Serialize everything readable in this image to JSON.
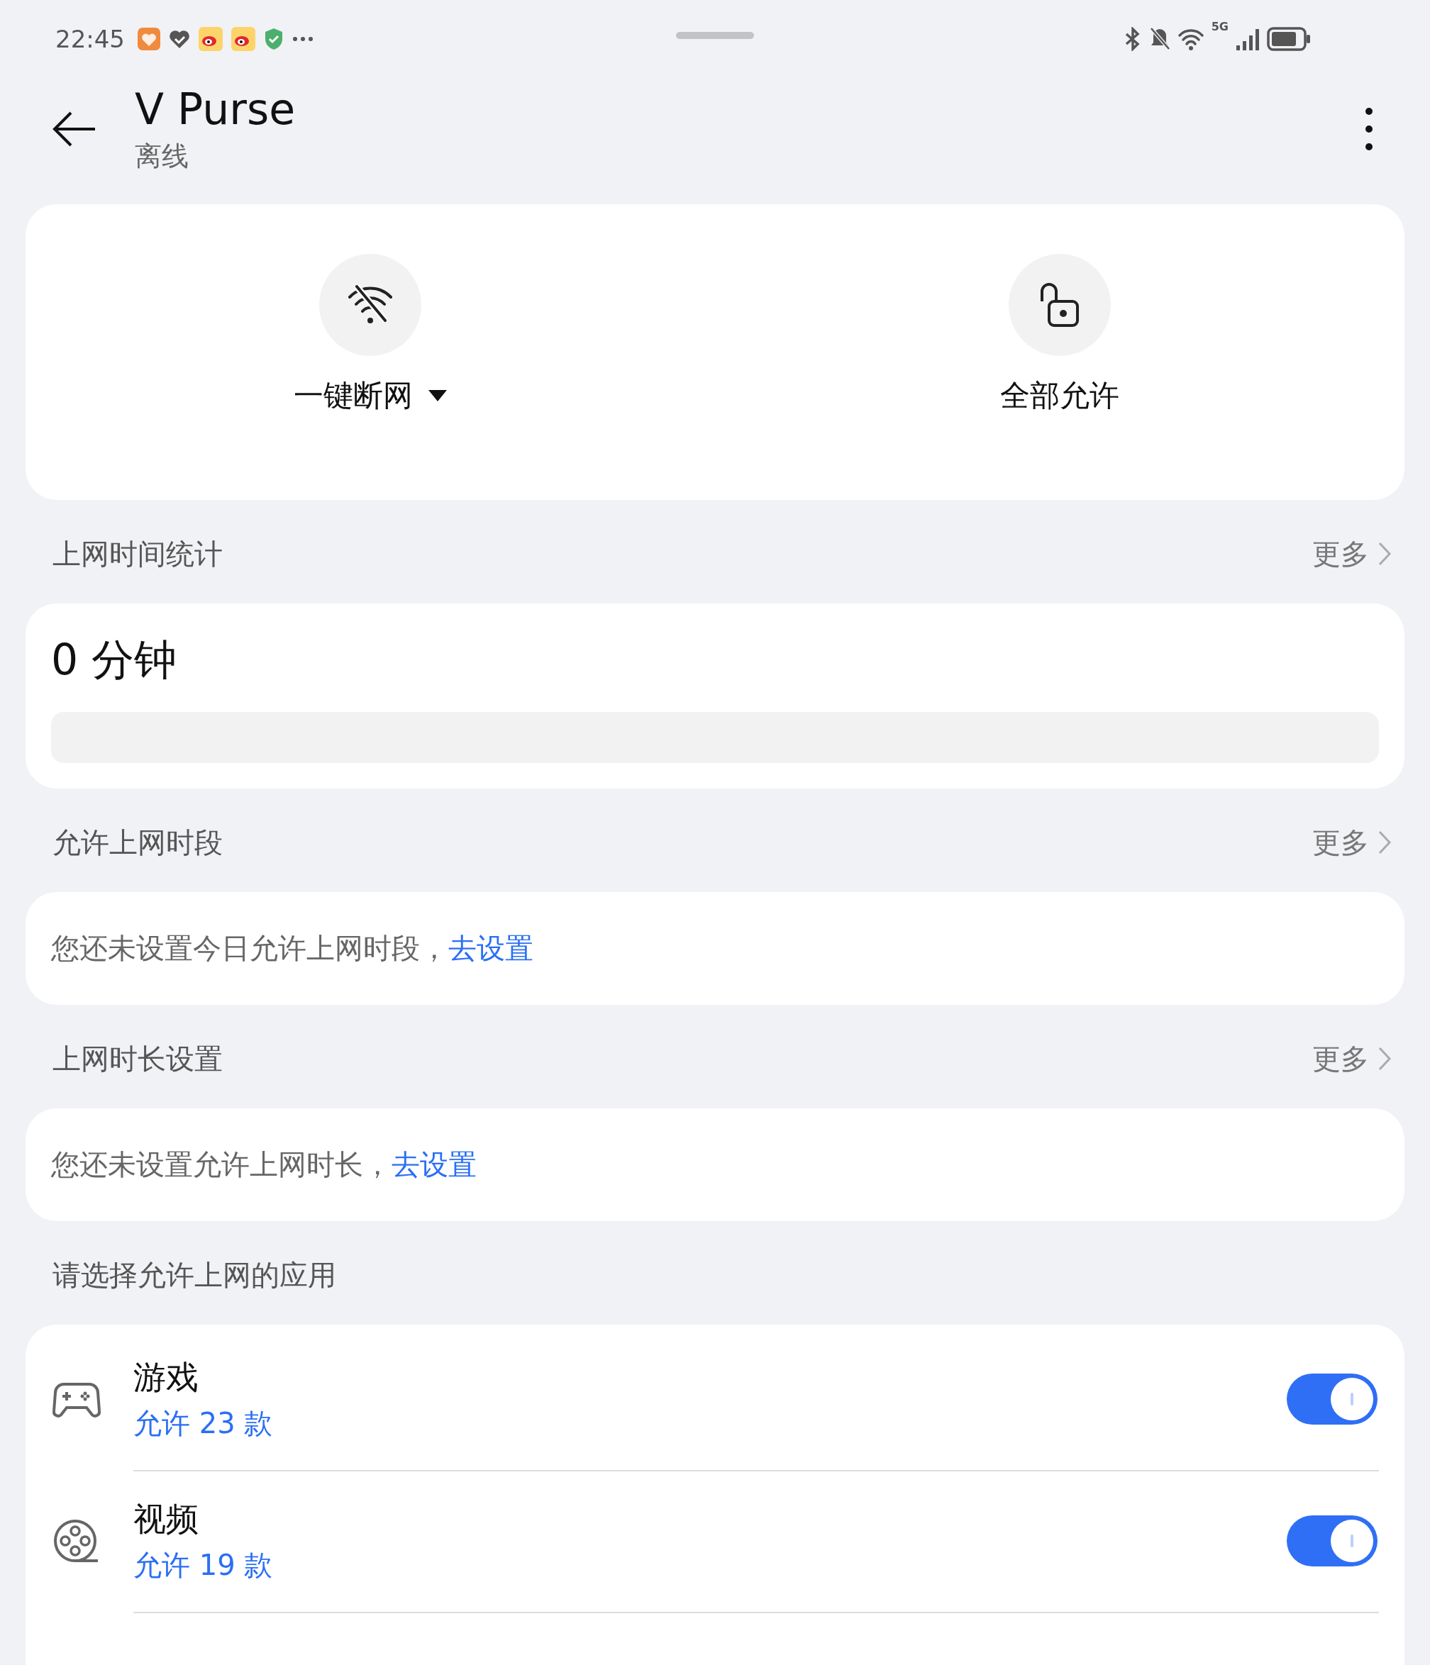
{
  "status_bar": {
    "time": "22:45",
    "network": "5G"
  },
  "header": {
    "title": "V Purse",
    "subtitle": "离线"
  },
  "actions": [
    {
      "label": "一键断网",
      "kind": "dropdown"
    },
    {
      "label": "全部允许",
      "kind": "plain"
    }
  ],
  "sections": [
    {
      "kind": "stat",
      "title": "上网时间统计",
      "more": "更多",
      "value": "0 分钟"
    },
    {
      "kind": "notice",
      "title": "允许上网时段",
      "more": "更多",
      "text": "您还未设置今日允许上网时段，",
      "link": "去设置"
    },
    {
      "kind": "notice",
      "title": "上网时长设置",
      "more": "更多",
      "text": "您还未设置允许上网时长，",
      "link": "去设置"
    },
    {
      "kind": "apps",
      "title": "请选择允许上网的应用",
      "apps": [
        {
          "name": "游戏",
          "count": "允许 23 款",
          "on": true
        },
        {
          "name": "视频",
          "count": "允许 19 款",
          "on": true
        }
      ]
    }
  ]
}
